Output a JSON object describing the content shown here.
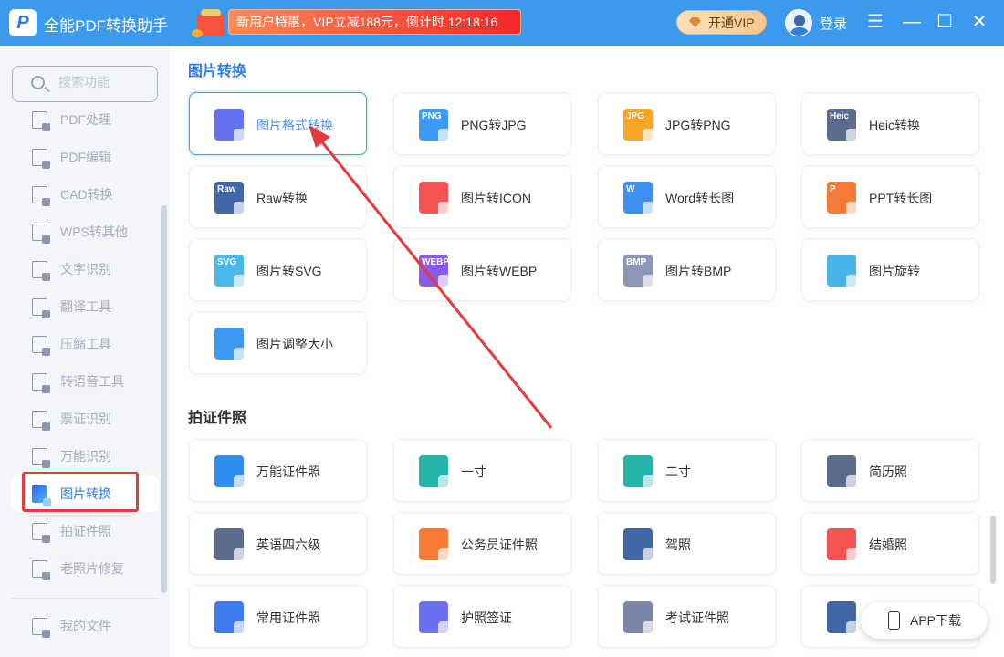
{
  "topbar": {
    "logo_text": "P",
    "title": "全能PDF转换助手",
    "promo": "新用户特惠，VIP立减188元，倒计时 12:18:16",
    "vip_button": "开通VIP",
    "login": "登录",
    "menu_icon": "☰",
    "minimize_icon": "—",
    "maximize_icon": "☐",
    "close_icon": "✕"
  },
  "sidebar": {
    "search_placeholder": "搜索功能",
    "items": [
      {
        "label": "PDF处理",
        "active": false
      },
      {
        "label": "PDF编辑",
        "active": false
      },
      {
        "label": "CAD转换",
        "active": false
      },
      {
        "label": "WPS转其他",
        "active": false
      },
      {
        "label": "文字识别",
        "active": false
      },
      {
        "label": "翻译工具",
        "active": false
      },
      {
        "label": "压缩工具",
        "active": false
      },
      {
        "label": "转语音工具",
        "active": false
      },
      {
        "label": "票证识别",
        "active": false
      },
      {
        "label": "万能识别",
        "active": false
      },
      {
        "label": "图片转换",
        "active": true
      },
      {
        "label": "拍证件照",
        "active": false
      },
      {
        "label": "老照片修复",
        "active": false
      }
    ],
    "my_files": "我的文件"
  },
  "sections": [
    {
      "title": "图片转换",
      "cards": [
        {
          "label": "图片格式转换",
          "color": "#6673f0",
          "tag": "",
          "selected": true
        },
        {
          "label": "PNG转JPG",
          "color": "#3d9af0",
          "tag": "PNG"
        },
        {
          "label": "JPG转PNG",
          "color": "#f6a623",
          "tag": "JPG"
        },
        {
          "label": "Heic转换",
          "color": "#5d6b8c",
          "tag": "Heic"
        },
        {
          "label": "Raw转换",
          "color": "#4366a6",
          "tag": "Raw"
        },
        {
          "label": "图片转ICON",
          "color": "#f55353",
          "tag": ""
        },
        {
          "label": "Word转长图",
          "color": "#3d8ff0",
          "tag": "W"
        },
        {
          "label": "PPT转长图",
          "color": "#f87a35",
          "tag": "P"
        },
        {
          "label": "图片转SVG",
          "color": "#4ab8e8",
          "tag": "SVG"
        },
        {
          "label": "图片转WEBP",
          "color": "#8a5ae8",
          "tag": "WEBP"
        },
        {
          "label": "图片转BMP",
          "color": "#8d97b5",
          "tag": "BMP"
        },
        {
          "label": "图片旋转",
          "color": "#4ab3e8",
          "tag": ""
        },
        {
          "label": "图片调整大小",
          "color": "#3d9af0",
          "tag": ""
        }
      ]
    },
    {
      "title": "拍证件照",
      "cards": [
        {
          "label": "万能证件照",
          "color": "#2f8cf0",
          "tag": ""
        },
        {
          "label": "一寸",
          "color": "#24b3a8",
          "tag": ""
        },
        {
          "label": "二寸",
          "color": "#24b3a8",
          "tag": ""
        },
        {
          "label": "简历照",
          "color": "#5d6b8c",
          "tag": ""
        },
        {
          "label": "英语四六级",
          "color": "#5d6b8c",
          "tag": ""
        },
        {
          "label": "公务员证件照",
          "color": "#f87a35",
          "tag": ""
        },
        {
          "label": "驾照",
          "color": "#4366a6",
          "tag": ""
        },
        {
          "label": "结婚照",
          "color": "#f55353",
          "tag": ""
        },
        {
          "label": "常用证件照",
          "color": "#3d7cf0",
          "tag": ""
        },
        {
          "label": "护照签证",
          "color": "#6c6ff0",
          "tag": ""
        },
        {
          "label": "考试证件照",
          "color": "#7a85a8",
          "tag": ""
        },
        {
          "label": "",
          "color": "#4366a6",
          "tag": ""
        }
      ]
    }
  ],
  "app_download": "APP下载"
}
